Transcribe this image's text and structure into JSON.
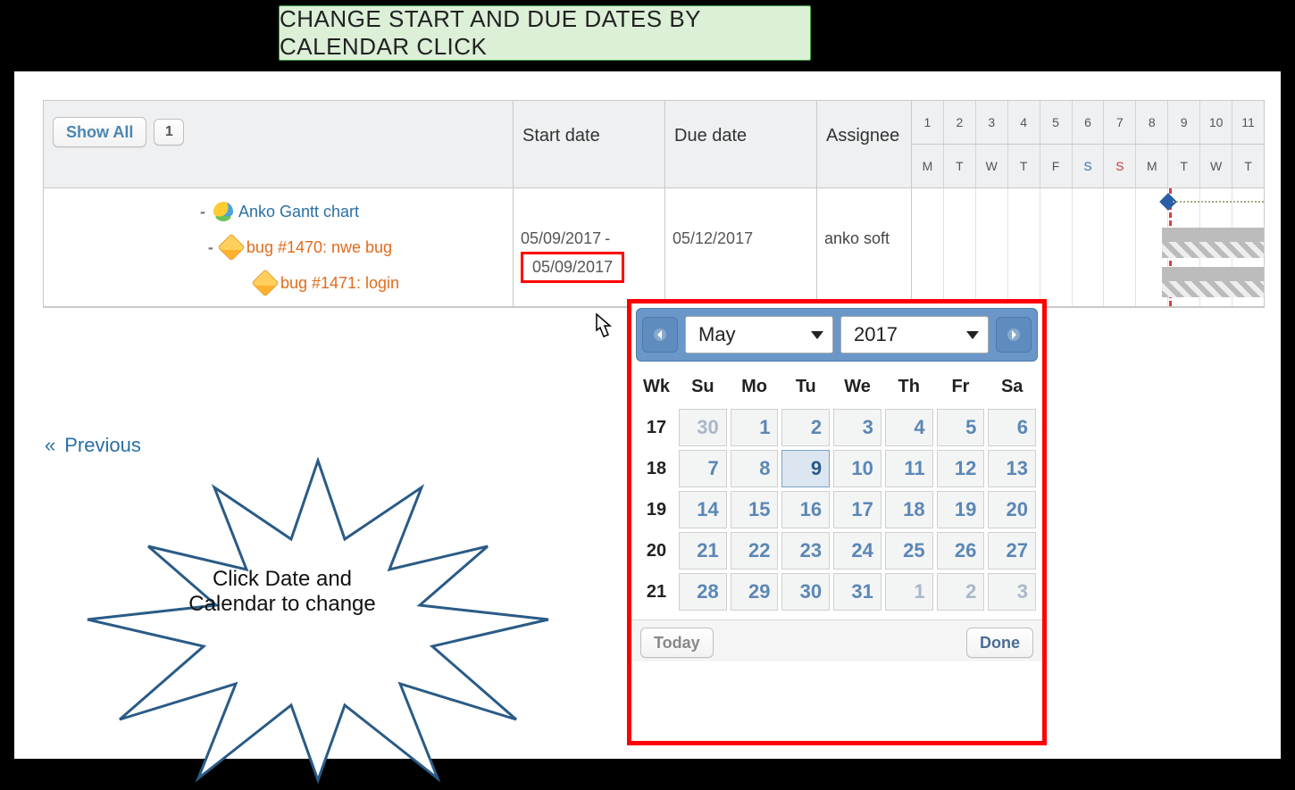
{
  "banner": "CHANGE START AND DUE DATES BY CALENDAR CLICK",
  "columns": {
    "start": "Start date",
    "due": "Due date",
    "assignee": "Assignee"
  },
  "toolbar": {
    "show_all": "Show All",
    "page": "1"
  },
  "nav": {
    "previous": "Previous"
  },
  "calendar_header": {
    "days": [
      "1",
      "2",
      "3",
      "4",
      "5",
      "6",
      "7",
      "8",
      "9",
      "10",
      "11"
    ],
    "weekdays": [
      "M",
      "T",
      "W",
      "T",
      "F",
      "S",
      "S",
      "M",
      "T",
      "W",
      "T"
    ]
  },
  "tree": {
    "project": "Anko Gantt chart",
    "issues": [
      {
        "label": "bug #1470: nwe bug",
        "start": "05/09/2017",
        "due": "05/12/2017",
        "assignee": "anko soft"
      },
      {
        "label": "bug #1471: login",
        "start": "05/09/2017",
        "due": "",
        "assignee": ""
      }
    ]
  },
  "callout": {
    "line1": "Click Date and",
    "line2": "Calendar to change"
  },
  "datepicker": {
    "month": "May",
    "year": "2017",
    "wk_label": "Wk",
    "dow": [
      "Su",
      "Mo",
      "Tu",
      "We",
      "Th",
      "Fr",
      "Sa"
    ],
    "weeks": [
      {
        "wk": "17",
        "days": [
          {
            "n": "30",
            "mute": true
          },
          {
            "n": "1"
          },
          {
            "n": "2"
          },
          {
            "n": "3"
          },
          {
            "n": "4"
          },
          {
            "n": "5"
          },
          {
            "n": "6"
          }
        ]
      },
      {
        "wk": "18",
        "days": [
          {
            "n": "7"
          },
          {
            "n": "8"
          },
          {
            "n": "9",
            "selected": true
          },
          {
            "n": "10"
          },
          {
            "n": "11"
          },
          {
            "n": "12"
          },
          {
            "n": "13"
          }
        ]
      },
      {
        "wk": "19",
        "days": [
          {
            "n": "14"
          },
          {
            "n": "15"
          },
          {
            "n": "16"
          },
          {
            "n": "17"
          },
          {
            "n": "18"
          },
          {
            "n": "19"
          },
          {
            "n": "20"
          }
        ]
      },
      {
        "wk": "20",
        "days": [
          {
            "n": "21"
          },
          {
            "n": "22"
          },
          {
            "n": "23"
          },
          {
            "n": "24"
          },
          {
            "n": "25"
          },
          {
            "n": "26"
          },
          {
            "n": "27"
          }
        ]
      },
      {
        "wk": "21",
        "days": [
          {
            "n": "28"
          },
          {
            "n": "29"
          },
          {
            "n": "30"
          },
          {
            "n": "31"
          },
          {
            "n": "1",
            "mute": true
          },
          {
            "n": "2",
            "mute": true
          },
          {
            "n": "3",
            "mute": true
          }
        ]
      }
    ],
    "today": "Today",
    "done": "Done"
  }
}
